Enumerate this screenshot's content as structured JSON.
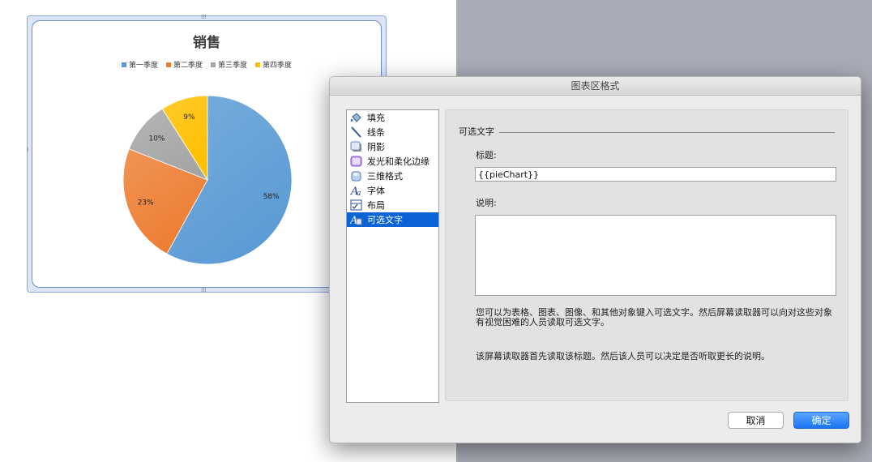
{
  "chart": {
    "title": "销售",
    "chart_data": {
      "type": "pie",
      "title": "销售",
      "categories": [
        "第一季度",
        "第二季度",
        "第三季度",
        "第四季度"
      ],
      "values": [
        58,
        23,
        10,
        9
      ],
      "labels": [
        "58%",
        "23%",
        "10%",
        "9%"
      ],
      "colors": [
        "#5b9bd5",
        "#ed7d31",
        "#a5a5a5",
        "#ffc000"
      ],
      "legend": "top"
    }
  },
  "dialog": {
    "title": "图表区格式",
    "categories": [
      {
        "label": "填充",
        "icon": "paint-bucket-icon"
      },
      {
        "label": "线条",
        "icon": "line-icon"
      },
      {
        "label": "阴影",
        "icon": "shadow-icon"
      },
      {
        "label": "发光和柔化边缘",
        "icon": "glow-icon"
      },
      {
        "label": "三维格式",
        "icon": "3d-format-icon"
      },
      {
        "label": "字体",
        "icon": "font-icon"
      },
      {
        "label": "布局",
        "icon": "layout-icon"
      },
      {
        "label": "可选文字",
        "icon": "alt-text-icon"
      }
    ],
    "selected_index": 7,
    "section_title": "可选文字",
    "title_label": "标题:",
    "title_value": "{{pieChart}}",
    "desc_label": "说明:",
    "desc_value": "",
    "help_text_1": "您可以为表格、图表、图像、和其他对象键入可选文字。然后屏幕读取器可以向对这些对象有视觉困难的人员读取可选文字。",
    "help_text_2": "该屏幕读取器首先读取该标题。然后该人员可以决定是否听取更长的说明。",
    "cancel_label": "取消",
    "ok_label": "确定"
  }
}
